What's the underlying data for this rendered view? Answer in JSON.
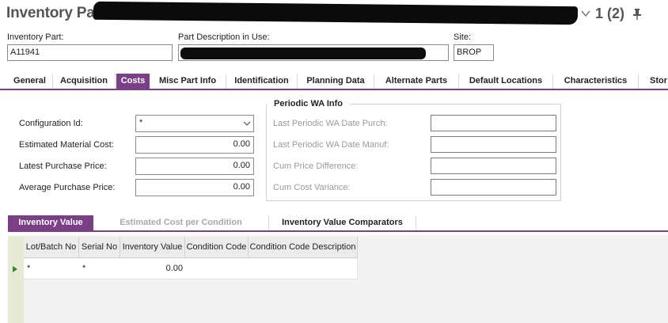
{
  "header": {
    "title": "Inventory Part",
    "record_count": "1 (2)"
  },
  "fields": {
    "inventory_part_label": "Inventory Part:",
    "inventory_part_value": "A11941",
    "part_desc_label": "Part Description in Use:",
    "part_desc_value": "",
    "site_label": "Site:",
    "site_value": "BROP"
  },
  "tabs": [
    "General",
    "Acquisition",
    "Costs",
    "Misc Part Info",
    "Identification",
    "Planning Data",
    "Alternate Parts",
    "Default Locations",
    "Characteristics",
    "Stor"
  ],
  "active_tab": "Costs",
  "costs": {
    "configuration_id_label": "Configuration Id:",
    "configuration_id_value": "*",
    "est_material_cost_label": "Estimated Material Cost:",
    "est_material_cost_value": "0.00",
    "latest_purchase_price_label": "Latest Purchase Price:",
    "latest_purchase_price_value": "0.00",
    "avg_purchase_price_label": "Average Purchase Price:",
    "avg_purchase_price_value": "0.00"
  },
  "periodic_wa": {
    "title": "Periodic WA Info",
    "date_purch_label": "Last Periodic WA Date Purch:",
    "date_manuf_label": "Last Periodic WA Date Manuf:",
    "cum_price_diff_label": "Cum Price Difference:",
    "cum_cost_var_label": "Cum Cost Variance:"
  },
  "lower_tabs": [
    "Inventory Value",
    "Estimated Cost per Condition",
    "Inventory Value Comparators"
  ],
  "lower_active_tab": "Inventory Value",
  "grid": {
    "columns": [
      "Lot/Batch No",
      "Serial No",
      "Inventory Value",
      "Condition Code",
      "Condition Code Description"
    ],
    "rows": [
      {
        "lot_batch_no": "*",
        "serial_no": "*",
        "inventory_value": "0.00",
        "condition_code": "",
        "condition_code_description": ""
      }
    ]
  },
  "colors": {
    "accent": "#7a3f86",
    "row_marker": "#2e8b2e"
  }
}
